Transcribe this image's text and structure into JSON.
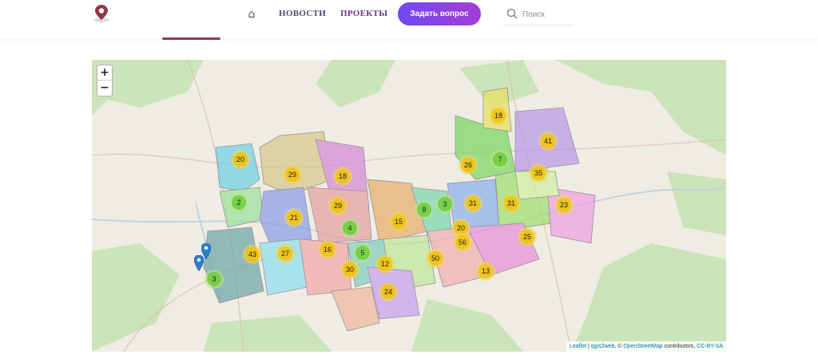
{
  "header": {
    "nav": {
      "news": "НОВОСТИ",
      "projects": "ПРОЕКТЫ",
      "ask_button": "Задать вопрос"
    },
    "search": {
      "placeholder": "Поиск"
    }
  },
  "icons": {
    "logo": "map-pin-logo-icon",
    "home": "home-icon",
    "search": "search-icon",
    "marker": "map-marker-icon"
  },
  "colors": {
    "accent_gradient_start": "#6f4af0",
    "accent_gradient_end": "#a33dd6",
    "nav_active": "#6a3585",
    "nav_underline": "#8e3a4a",
    "cluster_large": "#f0c20c",
    "cluster_small": "#6ecc39"
  },
  "map": {
    "zoom_in": "+",
    "zoom_out": "−",
    "clusters": [
      "18",
      "41",
      "20",
      "29",
      "18",
      "26",
      "7",
      "35",
      "2",
      "31",
      "31",
      "23",
      "29",
      "3",
      "8",
      "21",
      "15",
      "4",
      "20",
      "25",
      "56",
      "43",
      "27",
      "16",
      "5",
      "12",
      "50",
      "30",
      "13",
      "3",
      "24"
    ],
    "attribution": {
      "leaflet": "Leaflet",
      "sep1": " | ",
      "qgis": "qgis2web",
      "sep2": ", © ",
      "osm": "OpenStreetMap",
      "contributors": " contributors,",
      "license": "CC-BY-SA"
    }
  }
}
